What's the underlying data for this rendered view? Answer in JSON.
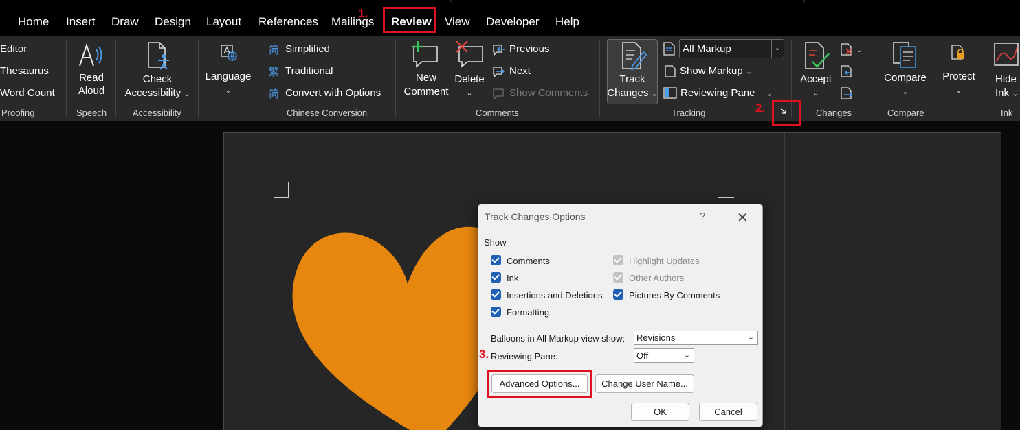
{
  "tabs": [
    "Home",
    "Insert",
    "Draw",
    "Design",
    "Layout",
    "References",
    "Mailings",
    "Review",
    "View",
    "Developer",
    "Help"
  ],
  "active_tab": "Review",
  "ribbon": {
    "proofing": {
      "items": [
        "Editor",
        "Thesaurus",
        "Word Count"
      ],
      "label": "Proofing"
    },
    "speech": {
      "button_line1": "Read",
      "button_line2": "Aloud",
      "label": "Speech"
    },
    "accessibility": {
      "button_line1": "Check",
      "button_line2": "Accessibility",
      "label": "Accessibility"
    },
    "language": {
      "button": "Language",
      "label": ""
    },
    "chinese": {
      "items": [
        "Simplified",
        "Traditional",
        "Convert with Options"
      ],
      "label": "Chinese Conversion"
    },
    "comments": {
      "new_line1": "New",
      "new_line2": "Comment",
      "delete": "Delete",
      "previous": "Previous",
      "next": "Next",
      "show_comments": "Show Comments",
      "label": "Comments"
    },
    "tracking": {
      "track_line1": "Track",
      "track_line2": "Changes",
      "markup_value": "All Markup",
      "show_markup": "Show Markup",
      "reviewing_pane": "Reviewing Pane",
      "label": "Tracking"
    },
    "changes": {
      "accept": "Accept",
      "label": "Changes"
    },
    "compare": {
      "button": "Compare",
      "label": "Compare"
    },
    "protect": {
      "button": "Protect",
      "label": ""
    },
    "ink": {
      "line1": "Hide",
      "line2": "Ink",
      "label": "Ink"
    }
  },
  "dialog": {
    "title": "Track Changes Options",
    "help": "?",
    "close": "✕",
    "show_label": "Show",
    "checkboxes_left": [
      {
        "label": "Comments",
        "checked": true
      },
      {
        "label": "Ink",
        "checked": true
      },
      {
        "label": "Insertions and Deletions",
        "checked": true
      },
      {
        "label": "Formatting",
        "checked": true
      }
    ],
    "checkboxes_right": [
      {
        "label": "Highlight Updates",
        "checked": true,
        "disabled": true
      },
      {
        "label": "Other Authors",
        "checked": true,
        "disabled": true
      },
      {
        "label": "Pictures By Comments",
        "checked": true,
        "disabled": false
      }
    ],
    "balloons_label": "Balloons in All Markup view show:",
    "balloons_value": "Revisions",
    "reviewing_pane_label": "Reviewing Pane:",
    "reviewing_pane_value": "Off",
    "advanced_button": "Advanced Options...",
    "change_user_button": "Change User Name...",
    "ok_button": "OK",
    "cancel_button": "Cancel"
  },
  "annotations": [
    "1.",
    "2.",
    "3."
  ],
  "colors": {
    "annotation": "#e01020",
    "heart": "#e8870f",
    "checkbox": "#1f5fb4"
  }
}
